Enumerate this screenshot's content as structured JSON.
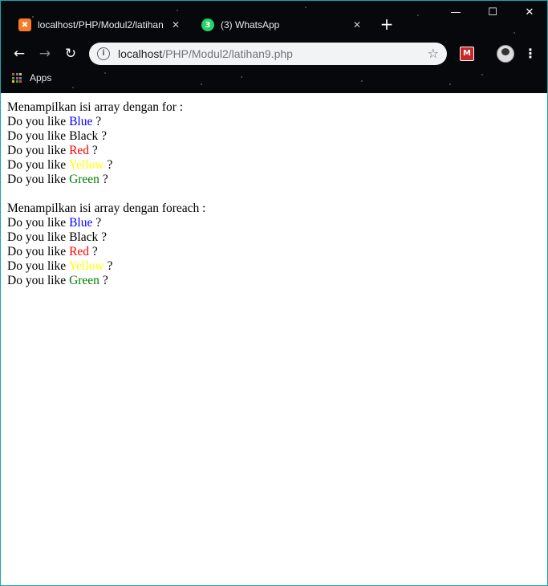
{
  "browser": {
    "tabs": [
      {
        "title": "localhost/PHP/Modul2/latihan",
        "icon": "xampp-icon"
      },
      {
        "title": "(3) WhatsApp",
        "icon": "whatsapp-icon",
        "badge": "3"
      }
    ],
    "address_host": "localhost",
    "address_path": "/PHP/Modul2/latihan9.php",
    "bookmarks_apps_label": "Apps"
  },
  "page": {
    "for_heading": "Menampilkan isi array dengan for :",
    "foreach_heading": "Menampilkan isi array dengan foreach :",
    "prefix": "Do you like ",
    "suffix": " ?",
    "colors": [
      {
        "name": "Blue",
        "color": "#0000ff"
      },
      {
        "name": "Black",
        "color": "#000000"
      },
      {
        "name": "Red",
        "color": "#ff0000"
      },
      {
        "name": "Yellow",
        "color": "#ffff00"
      },
      {
        "name": "Green",
        "color": "#008000"
      }
    ]
  }
}
